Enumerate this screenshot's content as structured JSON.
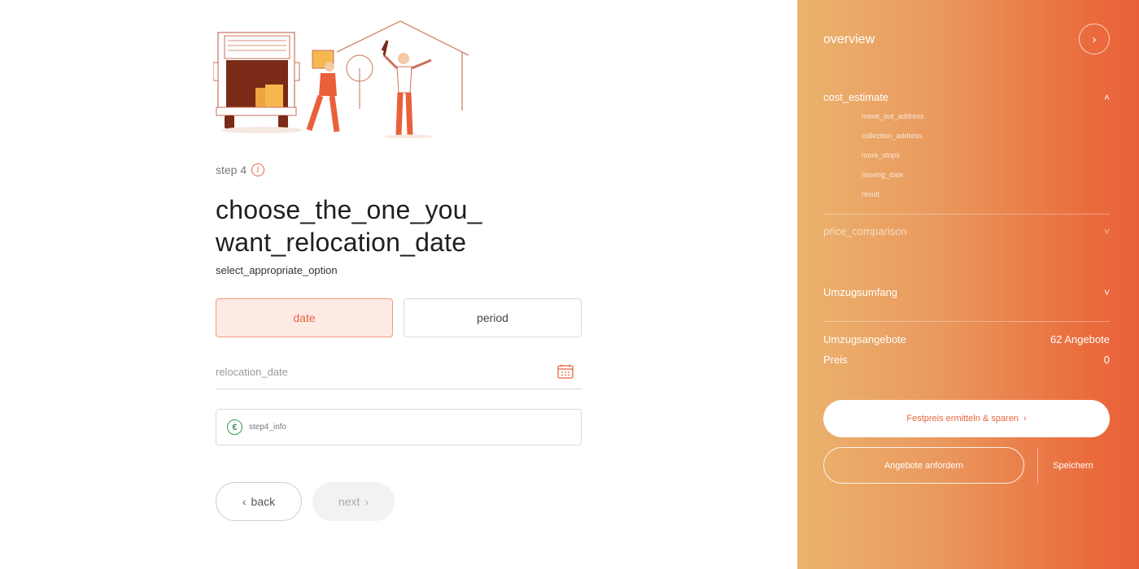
{
  "step": {
    "label": "step 4",
    "info_icon": "i"
  },
  "title": "choose_the_one_you_ want_relocation_date",
  "subtitle": "select_appropriate_option",
  "options": {
    "date": "date",
    "period": "period"
  },
  "date_field": {
    "placeholder": "relocation_date"
  },
  "info_box": {
    "euro_symbol": "€",
    "text": "step4_info"
  },
  "nav": {
    "back": "back",
    "back_icon": "‹",
    "next": "next",
    "next_icon": "›"
  },
  "panel": {
    "title": "overview",
    "toggle_icon": "›",
    "cost_estimate": {
      "label": "cost_estimate",
      "chevron": "˄",
      "items": [
        "move_out_address",
        "collection_address",
        "more_stops",
        "moving_date",
        "result"
      ]
    },
    "price_comparison": {
      "label": "price_comparison",
      "chevron": "˅"
    },
    "umzugsumfang": {
      "label": "Umzugsumfang",
      "chevron": "˅"
    },
    "offers": {
      "label": "Umzugsangebote",
      "value": "62 Angebote"
    },
    "price": {
      "label": "Preis",
      "value": "0"
    },
    "festpreis_button": "Festpreis ermitteln & sparen",
    "festpreis_icon": "›",
    "angebote_button": "Angebote anfordern",
    "save_button": "Speichern"
  },
  "colors": {
    "accent": "#e8643f",
    "panel_start": "#ebb36e",
    "panel_end": "#e9603a",
    "euro_green": "#3a9a55"
  }
}
